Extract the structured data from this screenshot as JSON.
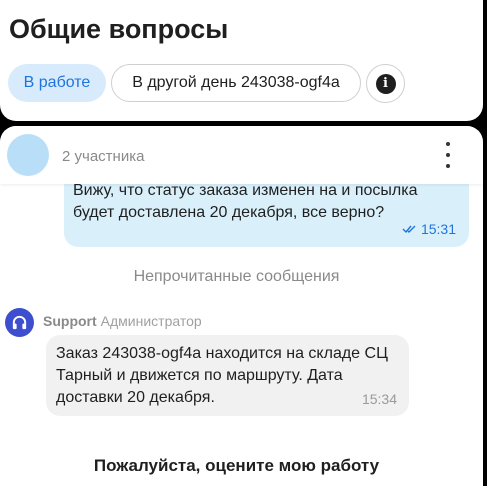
{
  "header": {
    "title": "Общие вопросы",
    "status_label": "В работе",
    "order_label": "В другой день 243038-ogf4a",
    "info_icon": "info-icon"
  },
  "chat": {
    "participants": "2 участника",
    "menu_icon": "more-vertical-icon",
    "outgoing": {
      "text": "Вижу, что статус заказа изменен на и посылка будет доставлена 20 декабря, все верно?",
      "time": "15:31",
      "read_icon": "double-check-icon"
    },
    "unread_divider": "Непрочитанные сообщения",
    "incoming": {
      "sender": "Support",
      "role": "Администратор",
      "avatar_icon": "headphones-icon",
      "text": "Заказ 243038-ogf4a находится на складе СЦ Тарный и движется по маршруту. Дата доставки 20 декабря.",
      "time": "15:34"
    },
    "rate_prompt": "Пожалуйста, оцените мою работу"
  },
  "colors": {
    "accent": "#1f74dc",
    "status_chip_bg": "#d7ebfd",
    "outgoing_bubble": "#d9f0fb",
    "incoming_bubble": "#f1f1f1",
    "support_avatar": "#3d4fcf"
  }
}
